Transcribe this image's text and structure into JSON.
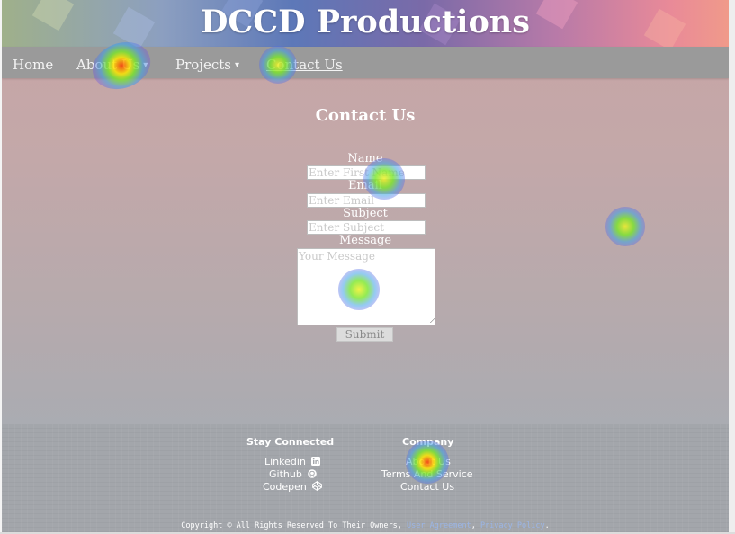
{
  "header": {
    "title": "DCCD Productions"
  },
  "nav": {
    "items": [
      {
        "label": "Home"
      },
      {
        "label": "About Us",
        "caret": "▾"
      },
      {
        "label": "Projects",
        "caret": "▾"
      },
      {
        "label": "Contact Us"
      }
    ]
  },
  "contact": {
    "title": "Contact Us",
    "name_label": "Name",
    "name_placeholder": "Enter First Name",
    "email_label": "Email",
    "email_placeholder": "Enter Email",
    "subject_label": "Subject",
    "subject_placeholder": "Enter Subject",
    "message_label": "Message",
    "message_placeholder": "Your Message",
    "submit_label": "Submit"
  },
  "footer": {
    "stay_connected": {
      "heading": "Stay Connected",
      "links": [
        {
          "label": "Linkedin",
          "icon": "linkedin-icon"
        },
        {
          "label": "Github",
          "icon": "github-icon"
        },
        {
          "label": "Codepen",
          "icon": "codepen-icon"
        }
      ]
    },
    "company": {
      "heading": "Company",
      "links": [
        {
          "label": "About Us"
        },
        {
          "label": "Terms And Service"
        },
        {
          "label": "Contact Us"
        }
      ]
    },
    "copyright": {
      "prefix": "Copyright © All Rights Reserved To Their Owners, ",
      "user_agreement": "User Agreement",
      "separator": ", ",
      "privacy_policy": "Privacy Policy",
      "suffix": "."
    }
  },
  "colors": {
    "nav_background": "#9a9a9a",
    "link_accent": "#9ab5e6",
    "text": "#ffffff"
  }
}
